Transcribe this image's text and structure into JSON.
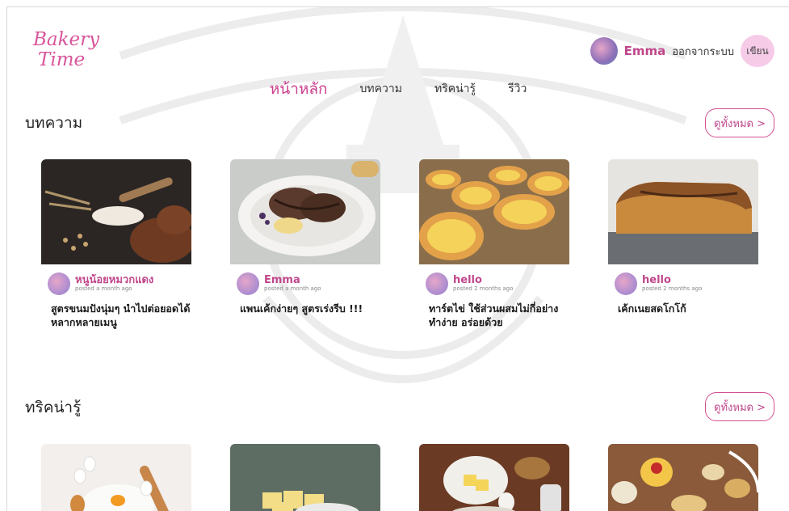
{
  "brand": {
    "line1": "Bakery",
    "line2": "Time"
  },
  "user": {
    "name": "Emma",
    "logout_label": "ออกจากระบบ",
    "write_label": "เขียน"
  },
  "nav": [
    {
      "label": "หน้าหลัก",
      "active": true
    },
    {
      "label": "บทความ",
      "active": false
    },
    {
      "label": "ทริคน่ารู้",
      "active": false
    },
    {
      "label": "รีวิว",
      "active": false
    }
  ],
  "articles": {
    "heading": "บทความ",
    "view_all": "ดูทั้งหมด >",
    "cards": [
      {
        "author": "หนูน้อยหมวกแดง",
        "posted": "posted a month ago",
        "title": "สูตรขนมปังนุ่มๆ นำไปต่อยอดได้หลากหลายเมนู",
        "image": "bread-and-flour"
      },
      {
        "author": "Emma",
        "posted": "posted a month ago",
        "title": "แพนเค้กง่ายๆ สูตรเร่งรีบ !!!",
        "image": "chocolate-pancakes"
      },
      {
        "author": "hello",
        "posted": "posted 2 months ago",
        "title": "ทาร์ตไข่ ใช้ส่วนผสมไม่กี่อย่าง ทำง่าย อร่อยด้วย",
        "image": "egg-tarts"
      },
      {
        "author": "hello",
        "posted": "posted 2 months ago",
        "title": "เค้กเนยสดโกโก้",
        "image": "butter-loaf-cake"
      }
    ]
  },
  "tricks": {
    "heading": "ทริคน่ารู้",
    "view_all": "ดูทั้งหมด >",
    "cards": [
      {
        "image": "eggs-and-rolling-pin"
      },
      {
        "image": "butter-cubes"
      },
      {
        "image": "baking-ingredients"
      },
      {
        "image": "assorted-cookies"
      }
    ]
  },
  "colors": {
    "accent": "#cc3f8e",
    "write_button": "#f6cbe8"
  }
}
